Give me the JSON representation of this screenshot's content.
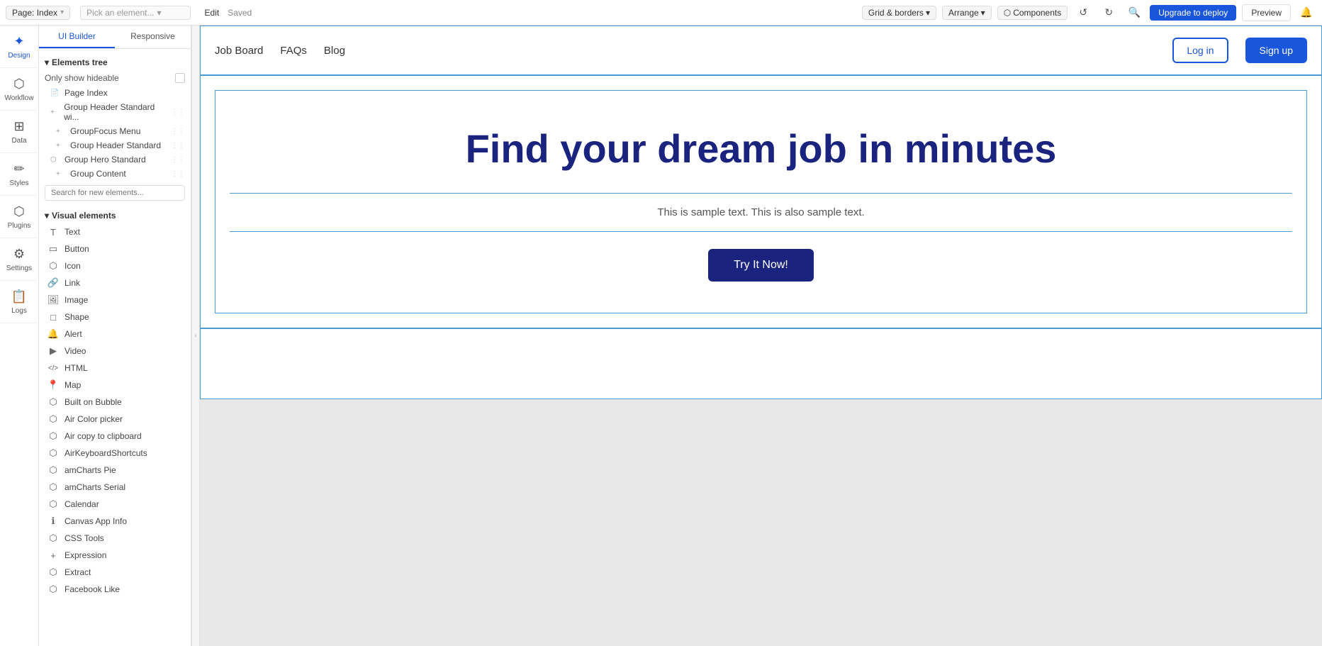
{
  "topbar": {
    "page_label": "Page: Index",
    "picker_placeholder": "Pick an element...",
    "edit_label": "Edit",
    "saved_label": "Saved",
    "grid_borders_label": "Grid & borders",
    "arrange_label": "Arrange",
    "components_label": "Components",
    "upgrade_label": "Upgrade to deploy",
    "preview_label": "Preview"
  },
  "left_sidebar": {
    "items": [
      {
        "id": "design",
        "label": "Design",
        "icon": "✦"
      },
      {
        "id": "workflow",
        "label": "Workflow",
        "icon": "⬡"
      },
      {
        "id": "data",
        "label": "Data",
        "icon": "⊞"
      },
      {
        "id": "styles",
        "label": "Styles",
        "icon": "✏"
      },
      {
        "id": "plugins",
        "label": "Plugins",
        "icon": "⬡"
      },
      {
        "id": "settings",
        "label": "Settings",
        "icon": "⚙"
      },
      {
        "id": "logs",
        "label": "Logs",
        "icon": "📋"
      }
    ]
  },
  "panel": {
    "tabs": [
      {
        "id": "ui-builder",
        "label": "UI Builder"
      },
      {
        "id": "responsive",
        "label": "Responsive"
      }
    ],
    "elements_tree_label": "Elements tree",
    "only_show_hideable": "Only show hideable",
    "page_index_label": "Page Index",
    "tree_items": [
      {
        "id": "group-header-standard-wi",
        "label": "Group Header Standard wi...",
        "indented": false,
        "has_handle": true
      },
      {
        "id": "groupfocus-menu",
        "label": "GroupFocus Menu",
        "indented": true,
        "has_handle": true
      },
      {
        "id": "group-header-standard",
        "label": "Group Header Standard",
        "indented": true,
        "has_handle": true
      },
      {
        "id": "group-hero-standard",
        "label": "Group Hero Standard",
        "indented": false,
        "has_handle": true
      },
      {
        "id": "group-content",
        "label": "Group Content",
        "indented": true,
        "has_handle": true
      }
    ],
    "search_placeholder": "Search for new elements...",
    "visual_elements_label": "Visual elements",
    "element_items": [
      {
        "id": "text",
        "label": "Text",
        "icon": "T"
      },
      {
        "id": "button",
        "label": "Button",
        "icon": "▭"
      },
      {
        "id": "icon",
        "label": "Icon",
        "icon": "⬡"
      },
      {
        "id": "link",
        "label": "Link",
        "icon": "🔗"
      },
      {
        "id": "image",
        "label": "Image",
        "icon": "🖼"
      },
      {
        "id": "shape",
        "label": "Shape",
        "icon": "□"
      },
      {
        "id": "alert",
        "label": "Alert",
        "icon": "🔔"
      },
      {
        "id": "video",
        "label": "Video",
        "icon": "▶"
      },
      {
        "id": "html",
        "label": "HTML",
        "icon": "</>"
      },
      {
        "id": "map",
        "label": "Map",
        "icon": "📍"
      },
      {
        "id": "built-on-bubble",
        "label": "Built on Bubble",
        "icon": "⬡"
      },
      {
        "id": "air-color-picker",
        "label": "Air Color picker",
        "icon": "⬡"
      },
      {
        "id": "air-copy-to-clipboard",
        "label": "Air copy to clipboard",
        "icon": "⬡"
      },
      {
        "id": "airkeyboard-shortcuts",
        "label": "AirKeyboardShortcuts",
        "icon": "⬡"
      },
      {
        "id": "amcharts-pie",
        "label": "amCharts Pie",
        "icon": "⬡"
      },
      {
        "id": "amcharts-serial",
        "label": "amCharts Serial",
        "icon": "⬡"
      },
      {
        "id": "calendar",
        "label": "Calendar",
        "icon": "⬡"
      },
      {
        "id": "canvas-app-info",
        "label": "Canvas App Info",
        "icon": "ℹ"
      },
      {
        "id": "css-tools",
        "label": "CSS Tools",
        "icon": "⬡"
      },
      {
        "id": "expression",
        "label": "Expression",
        "icon": "+"
      },
      {
        "id": "extract",
        "label": "Extract",
        "icon": "⬡"
      },
      {
        "id": "facebook-like",
        "label": "Facebook Like",
        "icon": "⬡"
      }
    ]
  },
  "canvas": {
    "nav": {
      "job_board": "Job Board",
      "faqs": "FAQs",
      "blog": "Blog",
      "login": "Log in",
      "signup": "Sign up"
    },
    "hero": {
      "title": "Find your dream job in minutes",
      "subtitle": "This is sample text. This is also sample text.",
      "cta": "Try It Now!"
    }
  }
}
